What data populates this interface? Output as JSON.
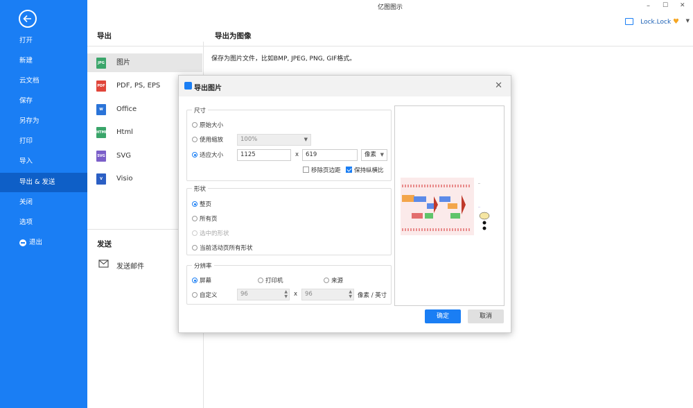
{
  "window": {
    "title": "亿图图示",
    "min": "–",
    "max": "☐",
    "close": "✕"
  },
  "user": {
    "name": "Lock.Lock"
  },
  "nav": {
    "items": [
      "打开",
      "新建",
      "云文档",
      "保存",
      "另存为",
      "打印",
      "导入",
      "导出 & 发送",
      "关闭",
      "选项",
      "退出"
    ],
    "active": "导出 & 发送"
  },
  "export": {
    "header": "导出",
    "types": [
      {
        "label": "图片",
        "badge": "JPG",
        "color": "#3aa56a"
      },
      {
        "label": "PDF, PS, EPS",
        "badge": "PDF",
        "color": "#e0453a"
      },
      {
        "label": "Office",
        "badge": "W",
        "color": "#2b74d8"
      },
      {
        "label": "Html",
        "badge": "HTML",
        "color": "#3aa56a"
      },
      {
        "label": "SVG",
        "badge": "SVG",
        "color": "#7b5fc9"
      },
      {
        "label": "Visio",
        "badge": "V",
        "color": "#2b5fc4"
      }
    ],
    "send_header": "发送",
    "send_item": "发送邮件"
  },
  "detail": {
    "title": "导出为图像",
    "description": "保存为图片文件，比如BMP, JPEG, PNG, GIF格式。"
  },
  "dialog": {
    "title": "导出图片",
    "size": {
      "label": "尺寸",
      "original": "原始大小",
      "use_scale": "使用缩放",
      "scale_value": "100%",
      "fit": "适应大小",
      "width": "1125",
      "x": "x",
      "height": "619",
      "unit": "像素",
      "remove_margin": "移除页边距",
      "keep_ratio": "保持纵横比"
    },
    "shape": {
      "label": "形状",
      "whole_page": "整页",
      "all_pages": "所有页",
      "selected": "选中的形状",
      "current_all": "当前活动页所有形状"
    },
    "resolution": {
      "label": "分辨率",
      "screen": "屏幕",
      "printer": "打印机",
      "source": "来源",
      "custom": "自定义",
      "dpi_x": "96",
      "x": "x",
      "dpi_y": "96",
      "unit": "像素 / 英寸"
    },
    "ok": "确定",
    "cancel": "取消"
  }
}
